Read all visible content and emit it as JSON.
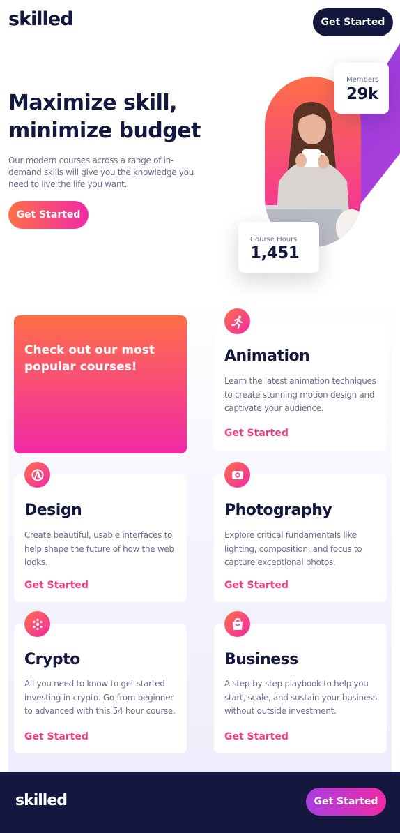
{
  "header": {
    "logo": "skilled",
    "cta_label": "Get Started"
  },
  "hero": {
    "title_line1": "Maximize skill,",
    "title_line2": "minimize budget",
    "description": "Our modern courses across a range of in-demand skills will give you the knowledge you need to live the life you want.",
    "cta_label": "Get Started",
    "stats": {
      "members_label": "Members",
      "members_value": "29k",
      "hours_label": "Course Hours",
      "hours_value": "1,451"
    }
  },
  "courses": {
    "promo_text": "Check out our most popular courses!",
    "items": [
      {
        "title": "Animation",
        "icon": "running-person-icon",
        "description": "Learn the latest animation techniques to create stunning motion design and captivate your audience.",
        "link": "Get Started"
      },
      {
        "title": "Design",
        "icon": "design-compass-icon",
        "description": "Create beautiful, usable interfaces to help shape the future of how the web looks.",
        "link": "Get Started"
      },
      {
        "title": "Photography",
        "icon": "camera-icon",
        "description": "Explore critical fundamentals like lighting, composition, and focus to capture exceptional photos.",
        "link": "Get Started"
      },
      {
        "title": "Crypto",
        "icon": "crypto-dots-icon",
        "description": "All you need to know to get started investing in crypto. Go from beginner to advanced with this 54 hour course.",
        "link": "Get Started"
      },
      {
        "title": "Business",
        "icon": "shopping-bag-icon",
        "description": "A step-by-step playbook to help you start, scale, and sustain your business without outside investment.",
        "link": "Get Started"
      }
    ]
  },
  "footer": {
    "logo": "skilled",
    "cta_label": "Get Started"
  },
  "colors": {
    "navy": "#14183e",
    "orange": "#ff6f48",
    "pink": "#f02aa6",
    "link_pink": "#f23b7f",
    "purple": "#a93ee0"
  }
}
